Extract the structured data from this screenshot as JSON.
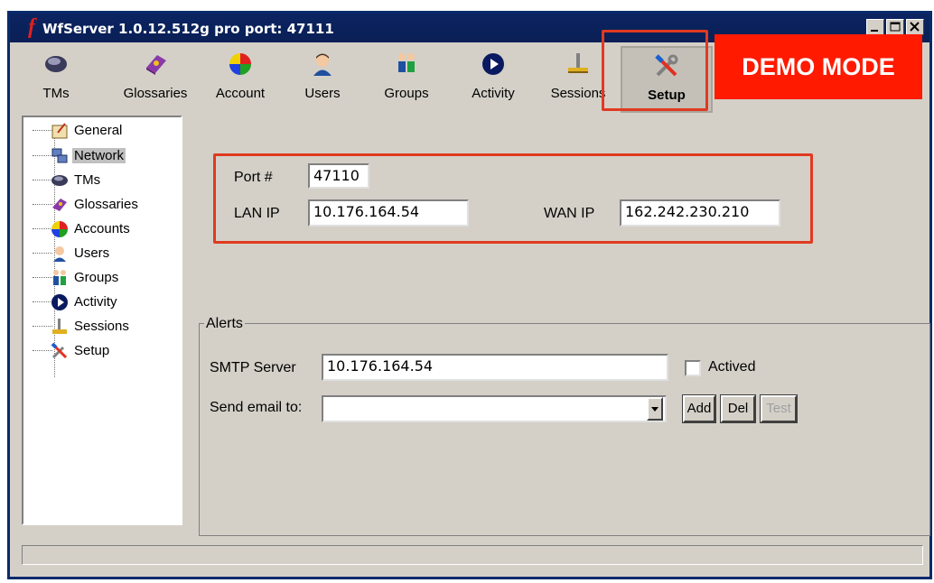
{
  "window": {
    "logo": "f",
    "title": "WfServer 1.0.12.512g pro   port: 47111"
  },
  "toolbar": {
    "items": [
      {
        "label": "TMs",
        "icon": "tms-icon"
      },
      {
        "label": "Glossaries",
        "icon": "glossaries-icon"
      },
      {
        "label": "Account",
        "icon": "account-icon"
      },
      {
        "label": "Users",
        "icon": "users-icon"
      },
      {
        "label": "Groups",
        "icon": "groups-icon"
      },
      {
        "label": "Activity",
        "icon": "activity-icon"
      },
      {
        "label": "Sessions",
        "icon": "sessions-icon"
      },
      {
        "label": "Setup",
        "icon": "setup-icon",
        "active": true
      }
    ],
    "demo_label": "DEMO MODE"
  },
  "tree": {
    "items": [
      {
        "label": "General",
        "icon": "general-icon"
      },
      {
        "label": "Network",
        "icon": "network-icon",
        "selected": true
      },
      {
        "label": "TMs",
        "icon": "tms-icon"
      },
      {
        "label": "Glossaries",
        "icon": "glossaries-icon"
      },
      {
        "label": "Accounts",
        "icon": "accounts-icon"
      },
      {
        "label": "Users",
        "icon": "users-icon"
      },
      {
        "label": "Groups",
        "icon": "groups-icon"
      },
      {
        "label": "Activity",
        "icon": "activity-icon"
      },
      {
        "label": "Sessions",
        "icon": "sessions-icon"
      },
      {
        "label": "Setup",
        "icon": "setup-icon"
      }
    ]
  },
  "network": {
    "port_label": "Port #",
    "port_value": "47110",
    "lan_label": "LAN IP",
    "lan_value": "10.176.164.54",
    "wan_label": "WAN IP",
    "wan_value": "162.242.230.210"
  },
  "alerts": {
    "title": "Alerts",
    "smtp_label": "SMTP Server",
    "smtp_value": "10.176.164.54",
    "actived_label": "Actived",
    "actived_checked": false,
    "send_label": "Send email to:",
    "send_value": "",
    "add_label": "Add",
    "del_label": "Del",
    "test_label": "Test"
  },
  "colors": {
    "titlebar": "#0b2461",
    "demo": "#ff1a00",
    "highlight_box": "#e03a20"
  }
}
